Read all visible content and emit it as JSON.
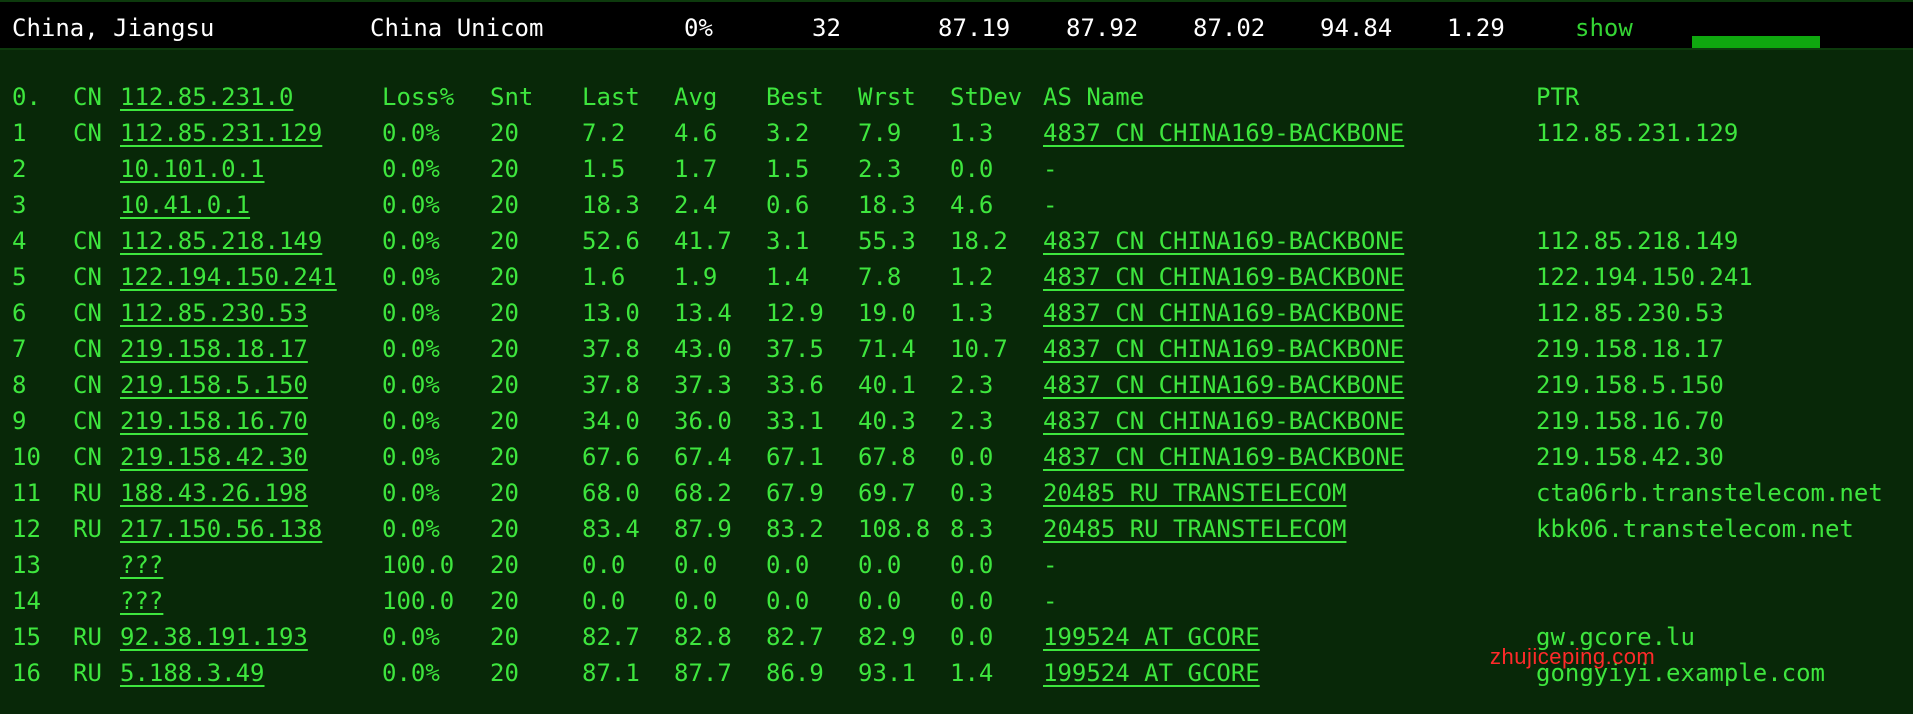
{
  "summary": {
    "location": "China, Jiangsu",
    "isp": "China Unicom",
    "loss": "0%",
    "sent": "32",
    "last": "87.19",
    "avg": "87.92",
    "best": "87.02",
    "worst": "94.84",
    "stdev": "1.29",
    "show_label": "show"
  },
  "table": {
    "header": {
      "hop": "0.",
      "cc": "CN",
      "host": "112.85.231.0",
      "loss": "Loss%",
      "snt": "Snt",
      "last": "Last",
      "avg": "Avg",
      "best": "Best",
      "wrst": "Wrst",
      "stdev": "StDev",
      "asname": "AS Name",
      "ptr": "PTR"
    },
    "rows": [
      {
        "hop": "1",
        "cc": "CN",
        "host": "112.85.231.129",
        "loss": "0.0%",
        "snt": "20",
        "last": "7.2",
        "avg": "4.6",
        "best": "3.2",
        "wrst": "7.9",
        "stdev": "1.3",
        "asname": "4837  CN CHINA169-BACKBONE",
        "ptr": "112.85.231.129"
      },
      {
        "hop": "2",
        "cc": "",
        "host": "10.101.0.1",
        "loss": "0.0%",
        "snt": "20",
        "last": "1.5",
        "avg": "1.7",
        "best": "1.5",
        "wrst": "2.3",
        "stdev": "0.0",
        "asname": "-",
        "ptr": ""
      },
      {
        "hop": "3",
        "cc": "",
        "host": "10.41.0.1",
        "loss": "0.0%",
        "snt": "20",
        "last": "18.3",
        "avg": "2.4",
        "best": "0.6",
        "wrst": "18.3",
        "stdev": "4.6",
        "asname": "-",
        "ptr": ""
      },
      {
        "hop": "4",
        "cc": "CN",
        "host": "112.85.218.149",
        "loss": "0.0%",
        "snt": "20",
        "last": "52.6",
        "avg": "41.7",
        "best": "3.1",
        "wrst": "55.3",
        "stdev": "18.2",
        "asname": "4837  CN CHINA169-BACKBONE",
        "ptr": "112.85.218.149"
      },
      {
        "hop": "5",
        "cc": "CN",
        "host": "122.194.150.241",
        "loss": "0.0%",
        "snt": "20",
        "last": "1.6",
        "avg": "1.9",
        "best": "1.4",
        "wrst": "7.8",
        "stdev": "1.2",
        "asname": "4837  CN CHINA169-BACKBONE",
        "ptr": "122.194.150.241"
      },
      {
        "hop": "6",
        "cc": "CN",
        "host": "112.85.230.53",
        "loss": "0.0%",
        "snt": "20",
        "last": "13.0",
        "avg": "13.4",
        "best": "12.9",
        "wrst": "19.0",
        "stdev": "1.3",
        "asname": "4837  CN CHINA169-BACKBONE",
        "ptr": "112.85.230.53"
      },
      {
        "hop": "7",
        "cc": "CN",
        "host": "219.158.18.17",
        "loss": "0.0%",
        "snt": "20",
        "last": "37.8",
        "avg": "43.0",
        "best": "37.5",
        "wrst": "71.4",
        "stdev": "10.7",
        "asname": "4837  CN CHINA169-BACKBONE",
        "ptr": "219.158.18.17"
      },
      {
        "hop": "8",
        "cc": "CN",
        "host": "219.158.5.150",
        "loss": "0.0%",
        "snt": "20",
        "last": "37.8",
        "avg": "37.3",
        "best": "33.6",
        "wrst": "40.1",
        "stdev": "2.3",
        "asname": "4837  CN CHINA169-BACKBONE",
        "ptr": "219.158.5.150"
      },
      {
        "hop": "9",
        "cc": "CN",
        "host": "219.158.16.70",
        "loss": "0.0%",
        "snt": "20",
        "last": "34.0",
        "avg": "36.0",
        "best": "33.1",
        "wrst": "40.3",
        "stdev": "2.3",
        "asname": "4837  CN CHINA169-BACKBONE",
        "ptr": "219.158.16.70"
      },
      {
        "hop": "10",
        "cc": "CN",
        "host": "219.158.42.30",
        "loss": "0.0%",
        "snt": "20",
        "last": "67.6",
        "avg": "67.4",
        "best": "67.1",
        "wrst": "67.8",
        "stdev": "0.0",
        "asname": "4837  CN CHINA169-BACKBONE",
        "ptr": "219.158.42.30"
      },
      {
        "hop": "11",
        "cc": "RU",
        "host": "188.43.26.198",
        "loss": "0.0%",
        "snt": "20",
        "last": "68.0",
        "avg": "68.2",
        "best": "67.9",
        "wrst": "69.7",
        "stdev": "0.3",
        "asname": "20485 RU TRANSTELECOM",
        "ptr": "cta06rb.transtelecom.net"
      },
      {
        "hop": "12",
        "cc": "RU",
        "host": "217.150.56.138",
        "loss": "0.0%",
        "snt": "20",
        "last": "83.4",
        "avg": "87.9",
        "best": "83.2",
        "wrst": "108.8",
        "stdev": "8.3",
        "asname": "20485 RU TRANSTELECOM",
        "ptr": "kbk06.transtelecom.net"
      },
      {
        "hop": "13",
        "cc": "",
        "host": "???",
        "loss": "100.0",
        "snt": "20",
        "last": "0.0",
        "avg": "0.0",
        "best": "0.0",
        "wrst": "0.0",
        "stdev": "0.0",
        "asname": "-",
        "ptr": ""
      },
      {
        "hop": "14",
        "cc": "",
        "host": "???",
        "loss": "100.0",
        "snt": "20",
        "last": "0.0",
        "avg": "0.0",
        "best": "0.0",
        "wrst": "0.0",
        "stdev": "0.0",
        "asname": "-",
        "ptr": ""
      },
      {
        "hop": "15",
        "cc": "RU",
        "host": "92.38.191.193",
        "loss": "0.0%",
        "snt": "20",
        "last": "82.7",
        "avg": "82.8",
        "best": "82.7",
        "wrst": "82.9",
        "stdev": "0.0",
        "asname": "199524 AT GCORE",
        "ptr": "gw.gcore.lu"
      },
      {
        "hop": "16",
        "cc": "RU",
        "host": "5.188.3.49",
        "loss": "0.0%",
        "snt": "20",
        "last": "87.1",
        "avg": "87.7",
        "best": "86.9",
        "wrst": "93.1",
        "stdev": "1.4",
        "asname": "199524 AT GCORE",
        "ptr": "gongyiyi.example.com"
      }
    ]
  },
  "watermark": "zhujiceping.com",
  "colors": {
    "background": "#082808",
    "text": "#3ee63e",
    "summary_bg": "#000000",
    "summary_text": "#ffffff",
    "bar": "#0fa80f",
    "watermark": "#ff2a2a"
  }
}
